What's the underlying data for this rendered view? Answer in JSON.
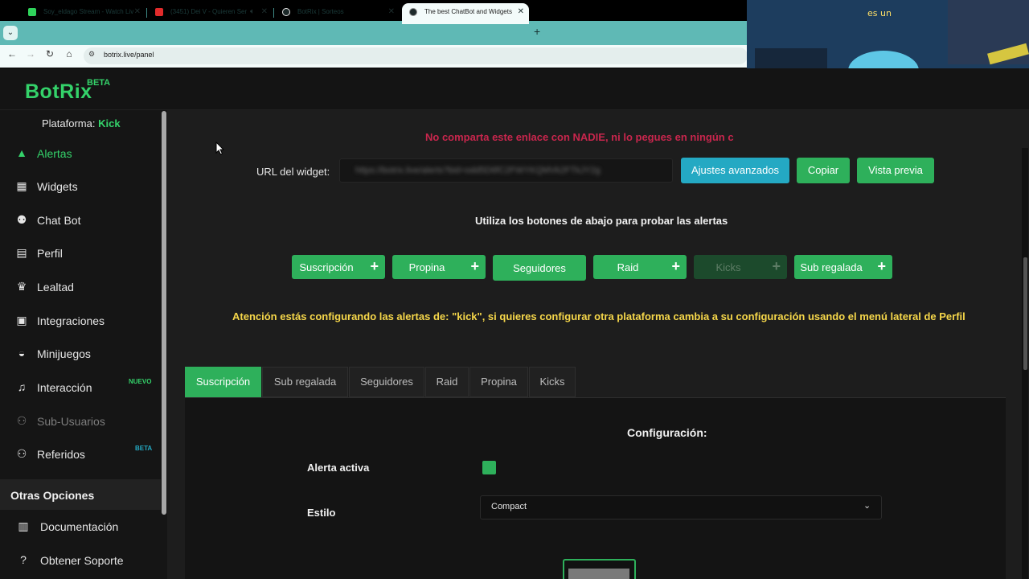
{
  "browser": {
    "tabs": [
      {
        "title": "Soy_eldago Stream - Watch Liv",
        "favicon": "kick-icon"
      },
      {
        "title": "(3451) Dei V - Quieren Ser",
        "favicon": "youtube-icon"
      },
      {
        "title": "BotRix | Sorteos",
        "favicon": "botrix-icon"
      },
      {
        "title": "The best ChatBot and Widgets",
        "favicon": "botrix-icon",
        "active": true
      }
    ],
    "url": "botrix.live/panel"
  },
  "app": {
    "logo": "BotRix",
    "logo_badge": "BETA",
    "accent": "#2eb05b"
  },
  "sidebar": {
    "platform_label": "Plataforma:",
    "platform_value": "Kick",
    "items": [
      {
        "label": "Alertas",
        "icon": "warning-icon",
        "active": true
      },
      {
        "label": "Widgets",
        "icon": "grid-icon"
      },
      {
        "label": "Chat Bot",
        "icon": "robot-icon"
      },
      {
        "label": "Perfil",
        "icon": "id-card-icon"
      },
      {
        "label": "Lealtad",
        "icon": "trophy-icon"
      },
      {
        "label": "Integraciones",
        "icon": "code-icon"
      },
      {
        "label": "Minijuegos",
        "icon": "gamepad-icon"
      },
      {
        "label": "Interacción",
        "icon": "music-icon",
        "badge": "NUEVO"
      },
      {
        "label": "Sub-Usuarios",
        "icon": "users-icon",
        "disabled": true
      },
      {
        "label": "Referidos",
        "icon": "user-group-icon",
        "badge": "BETA"
      }
    ],
    "section_other": "Otras Opciones",
    "other_items": [
      {
        "label": "Documentación",
        "icon": "scroll-icon"
      },
      {
        "label": "Obtener Soporte",
        "icon": "question-icon"
      }
    ]
  },
  "main": {
    "warning_top": "No comparta este enlace con NADIE, ni lo pegues en ningún c",
    "url_label": "URL del widget:",
    "url_value": "https://botrix.live/alerts?bid=odd5D6fC2FWYKQMVk2FTkJY2g",
    "buttons": {
      "advanced": "Ajustes avanzados",
      "copy": "Copiar",
      "preview": "Vista previa"
    },
    "test_hint": "Utiliza los botones de abajo para probar las alertas",
    "test_buttons": [
      {
        "label": "Suscripción",
        "plus": true
      },
      {
        "label": "Propina",
        "plus": true
      },
      {
        "label": "Seguidores",
        "plus": false
      },
      {
        "label": "Raid",
        "plus": true
      },
      {
        "label": "Kicks",
        "plus": true,
        "disabled": true
      },
      {
        "label": "Sub regalada",
        "plus": true
      }
    ],
    "attention": "Atención estás configurando las alertas de: \"kick\", si quieres configurar otra plataforma cambia a su configuración usando el menú lateral de Perfil",
    "tabs": [
      "Suscripción",
      "Sub regalada",
      "Seguidores",
      "Raid",
      "Propina",
      "Kicks"
    ],
    "config": {
      "title": "Configuración:",
      "active_label": "Alerta activa",
      "active_checked": true,
      "style_label": "Estilo",
      "style_value": "Compact"
    }
  }
}
